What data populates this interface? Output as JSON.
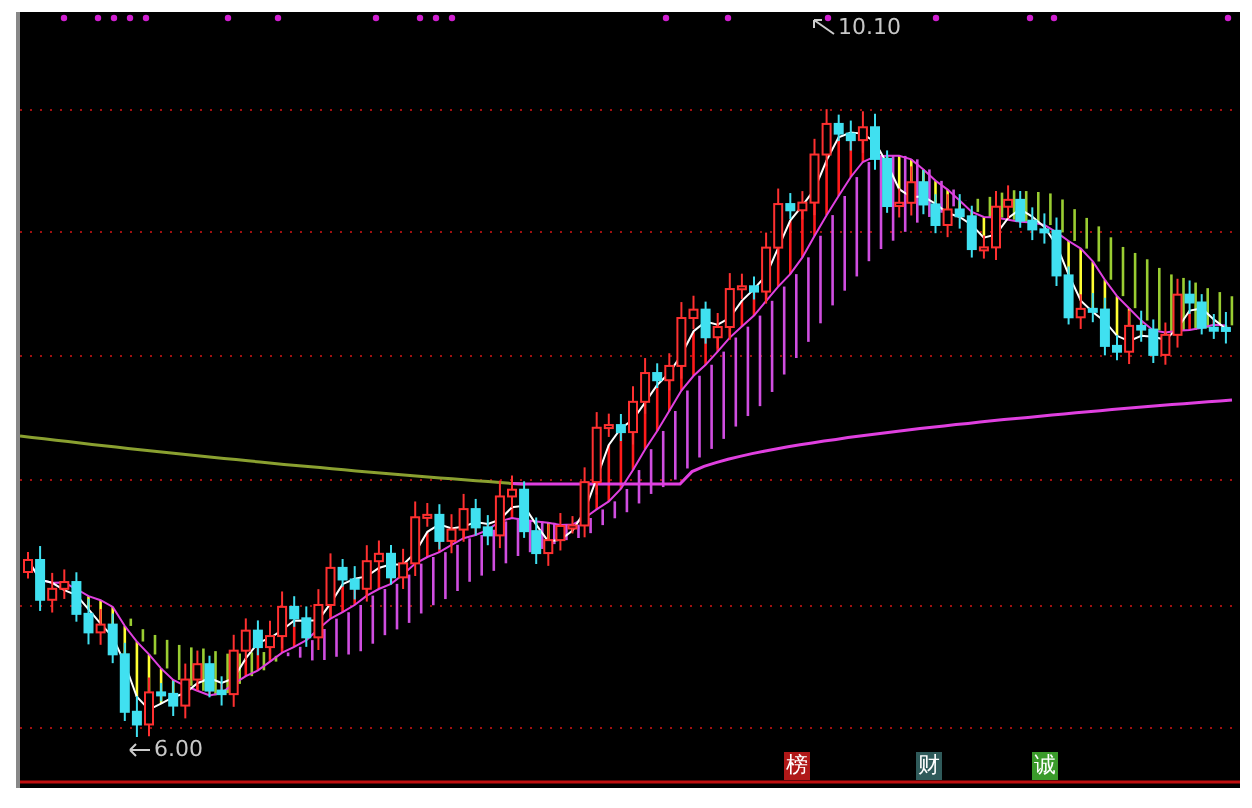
{
  "chart": {
    "high_label": "10.10",
    "low_label": "6.00"
  },
  "badges": [
    {
      "label": "榜",
      "color": "#b01818"
    },
    {
      "label": "财",
      "color": "#2f5a5a"
    },
    {
      "label": "诚",
      "color": "#3a9a2a"
    }
  ]
}
